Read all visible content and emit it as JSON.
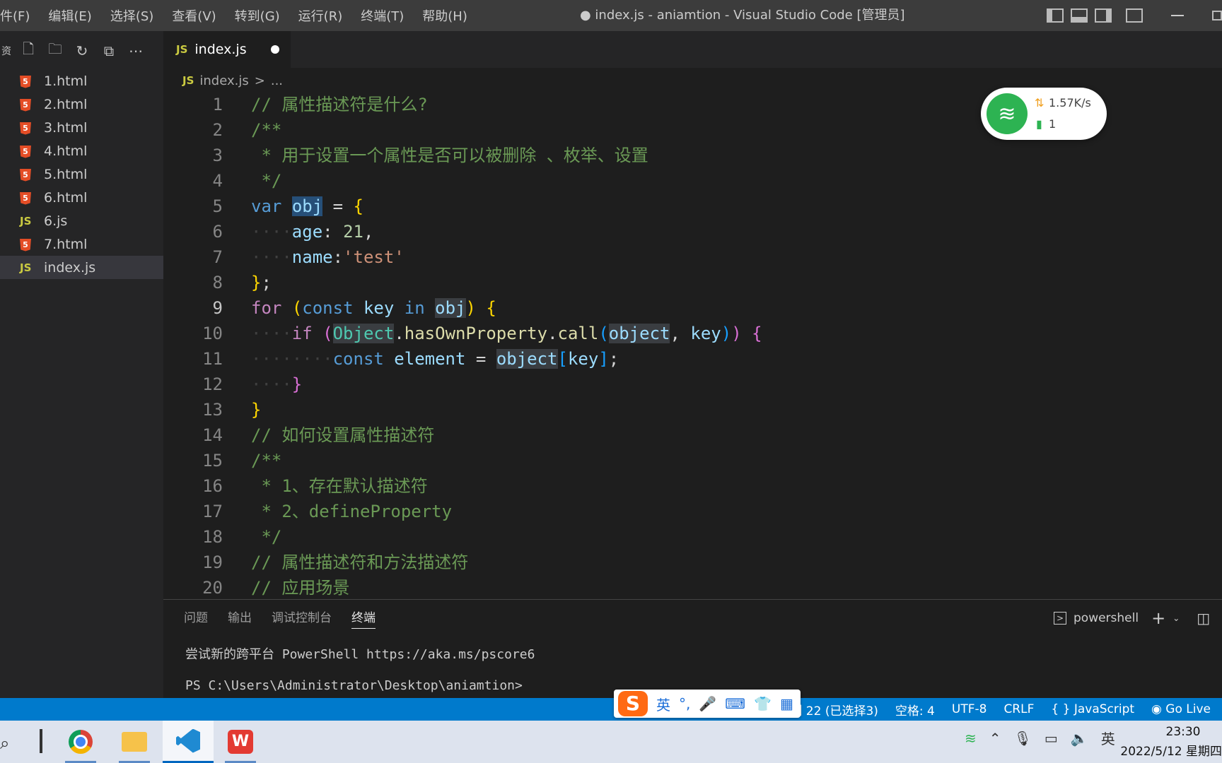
{
  "menu": [
    "件(F)",
    "编辑(E)",
    "选择(S)",
    "查看(V)",
    "转到(G)",
    "运行(R)",
    "终端(T)",
    "帮助(H)"
  ],
  "window_title": "● index.js - aniamtion - Visual Studio Code [管理员]",
  "explorer": {
    "toolbar_icons": [
      "new-file-icon",
      "new-folder-icon",
      "refresh-icon",
      "collapse-icon",
      "more-icon"
    ],
    "files": [
      {
        "name": "1.html",
        "type": "html"
      },
      {
        "name": "2.html",
        "type": "html"
      },
      {
        "name": "3.html",
        "type": "html"
      },
      {
        "name": "4.html",
        "type": "html"
      },
      {
        "name": "5.html",
        "type": "html"
      },
      {
        "name": "6.html",
        "type": "html"
      },
      {
        "name": "6.js",
        "type": "js"
      },
      {
        "name": "7.html",
        "type": "html"
      },
      {
        "name": "index.js",
        "type": "js",
        "active": true
      }
    ]
  },
  "tab": {
    "badge": "JS",
    "name": "index.js",
    "modified": true
  },
  "breadcrumb": {
    "badge": "JS",
    "file": "index.js",
    "sep": ">",
    "rest": "..."
  },
  "editor": {
    "current_line": 9,
    "line_numbers": [
      "1",
      "2",
      "3",
      "4",
      "5",
      "6",
      "7",
      "8",
      "9",
      "10",
      "11",
      "12",
      "13",
      "14",
      "15",
      "16",
      "17",
      "18",
      "19",
      "20"
    ]
  },
  "network_widget": {
    "speed": "1.57K/s",
    "count": "1"
  },
  "panel": {
    "tabs": [
      "问题",
      "输出",
      "调试控制台",
      "终端"
    ],
    "active_tab": "终端",
    "shell": "powershell",
    "terminal_lines": [
      "尝试新的跨平台 PowerShell https://aka.ms/pscore6",
      "PS C:\\Users\\Administrator\\Desktop\\aniamtion>"
    ]
  },
  "ime": {
    "mode": "英",
    "punct": "°,"
  },
  "statusbar": {
    "position": "列 22 (已选择3)",
    "spaces": "空格: 4",
    "encoding": "UTF-8",
    "eol": "CRLF",
    "language": "JavaScript",
    "golive": "Go Live"
  },
  "taskbar": {
    "time": "23:30",
    "date": "2022/5/12 星期四",
    "ime_indicator": "英"
  }
}
